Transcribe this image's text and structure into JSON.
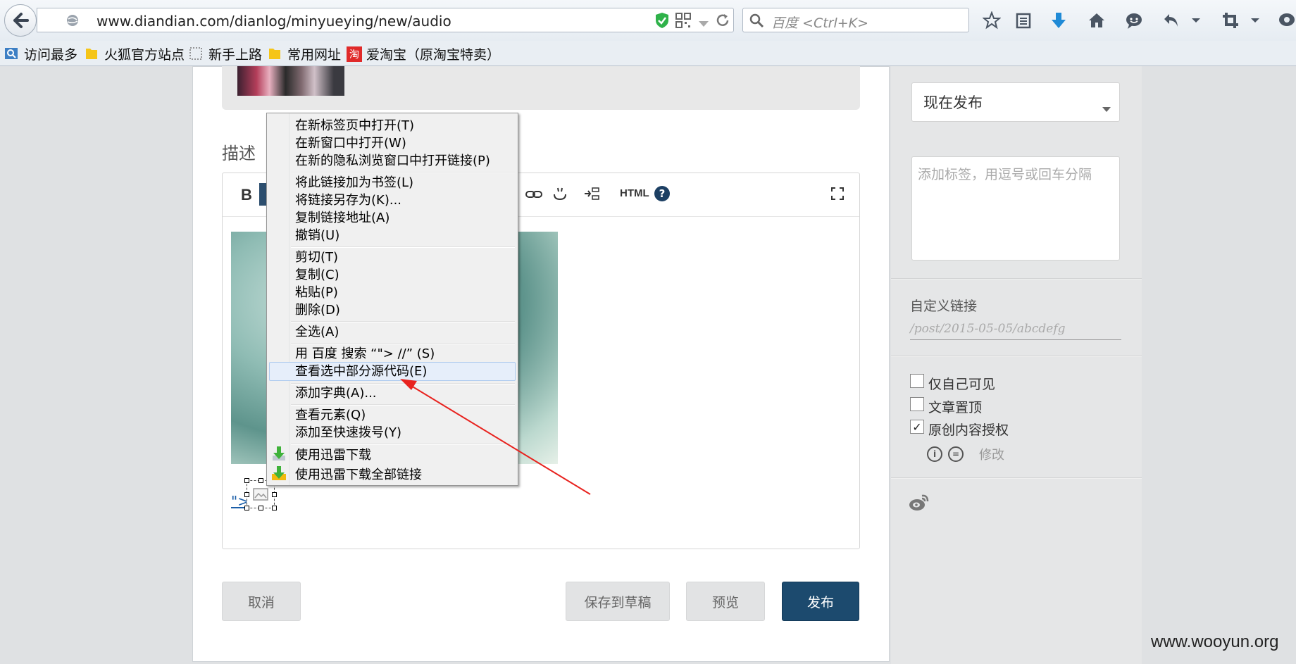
{
  "browser": {
    "url": "www.diandian.com/dianlog/minyueying/new/audio",
    "search_placeholder": "百度 <Ctrl+K>",
    "bookmarks": [
      "访问最多",
      "火狐官方站点",
      "新手上路",
      "常用网址",
      "爱淘宝（原淘宝特卖）"
    ]
  },
  "editor": {
    "description_label": "描述",
    "bold_label": "B",
    "html_label": "HTML",
    "link_text": "\">  //"
  },
  "context_menu": {
    "items": [
      "在新标签页中打开(T)",
      "在新窗口中打开(W)",
      "在新的隐私浏览窗口中打开链接(P)",
      "将此链接加为书签(L)",
      "将链接另存为(K)...",
      "复制链接地址(A)",
      "撤销(U)",
      "剪切(T)",
      "复制(C)",
      "粘贴(P)",
      "删除(D)",
      "全选(A)",
      "用 百度 搜索 “\"> //” (S)",
      "查看选中部分源代码(E)",
      "添加字典(A)...",
      "查看元素(Q)",
      "添加至快速拨号(Y)",
      "使用迅雷下载",
      "使用迅雷下载全部链接"
    ],
    "highlighted_index": 13
  },
  "actions": {
    "cancel": "取消",
    "save_draft": "保存到草稿",
    "preview": "预览",
    "publish": "发布"
  },
  "sidebar": {
    "publish_time": "现在发布",
    "tags_placeholder": "添加标签，用逗号或回车分隔",
    "custom_link_label": "自定义链接",
    "custom_link_placeholder": "/post/2015-05-05/abcdefg",
    "options": [
      {
        "label": "仅自己可见",
        "checked": false
      },
      {
        "label": "文章置顶",
        "checked": false
      },
      {
        "label": "原创内容授权",
        "checked": true
      }
    ],
    "license_edit": "修改"
  },
  "watermark": "www.wooyun.org",
  "colors": {
    "publish_button": "#1c4a6e",
    "link": "#1a5ea8",
    "annotation_arrow": "#e8231f"
  }
}
